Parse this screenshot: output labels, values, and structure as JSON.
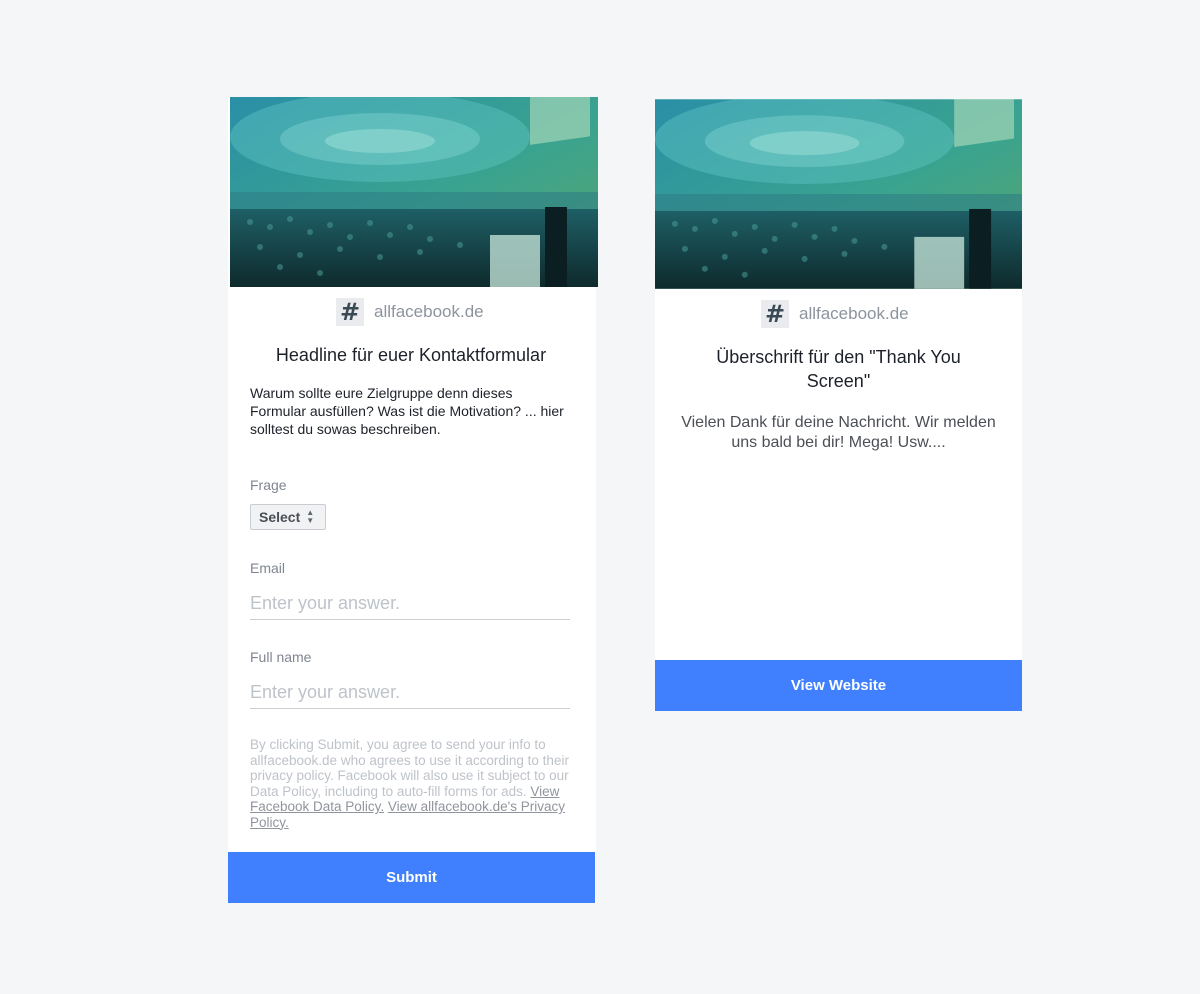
{
  "form_card": {
    "brand": {
      "icon": "hashtag-icon",
      "name": "allfacebook.de"
    },
    "headline": "Headline für euer Kontaktformular",
    "description": "Warum sollte eure Zielgruppe denn dieses Formular ausfüllen? Was ist die Motivation? ... hier solltest du sowas beschreiben.",
    "fields": {
      "frage": {
        "label": "Frage",
        "select_value": "Select"
      },
      "email": {
        "label": "Email",
        "placeholder": "Enter your answer."
      },
      "full_name": {
        "label": "Full name",
        "placeholder": "Enter your answer."
      }
    },
    "legal": {
      "text": "By clicking Submit, you agree to send your info to allfacebook.de who agrees to use it according to their privacy policy. Facebook will also use it subject to our Data Policy, including to auto-fill forms for ads.",
      "link_data_policy": "View Facebook Data Policy.",
      "link_privacy_policy": "View allfacebook.de's Privacy Policy."
    },
    "submit_label": "Submit"
  },
  "thank_you_card": {
    "brand": {
      "icon": "hashtag-icon",
      "name": "allfacebook.de"
    },
    "headline": "Überschrift für den \"Thank You Screen\"",
    "message": "Vielen Dank für deine Nachricht. Wir melden uns bald bei dir! Mega! Usw....",
    "button_label": "View Website"
  },
  "colors": {
    "background": "#f5f6f7",
    "accent": "#4080ff",
    "hero_tint": "#2f9aa0"
  }
}
